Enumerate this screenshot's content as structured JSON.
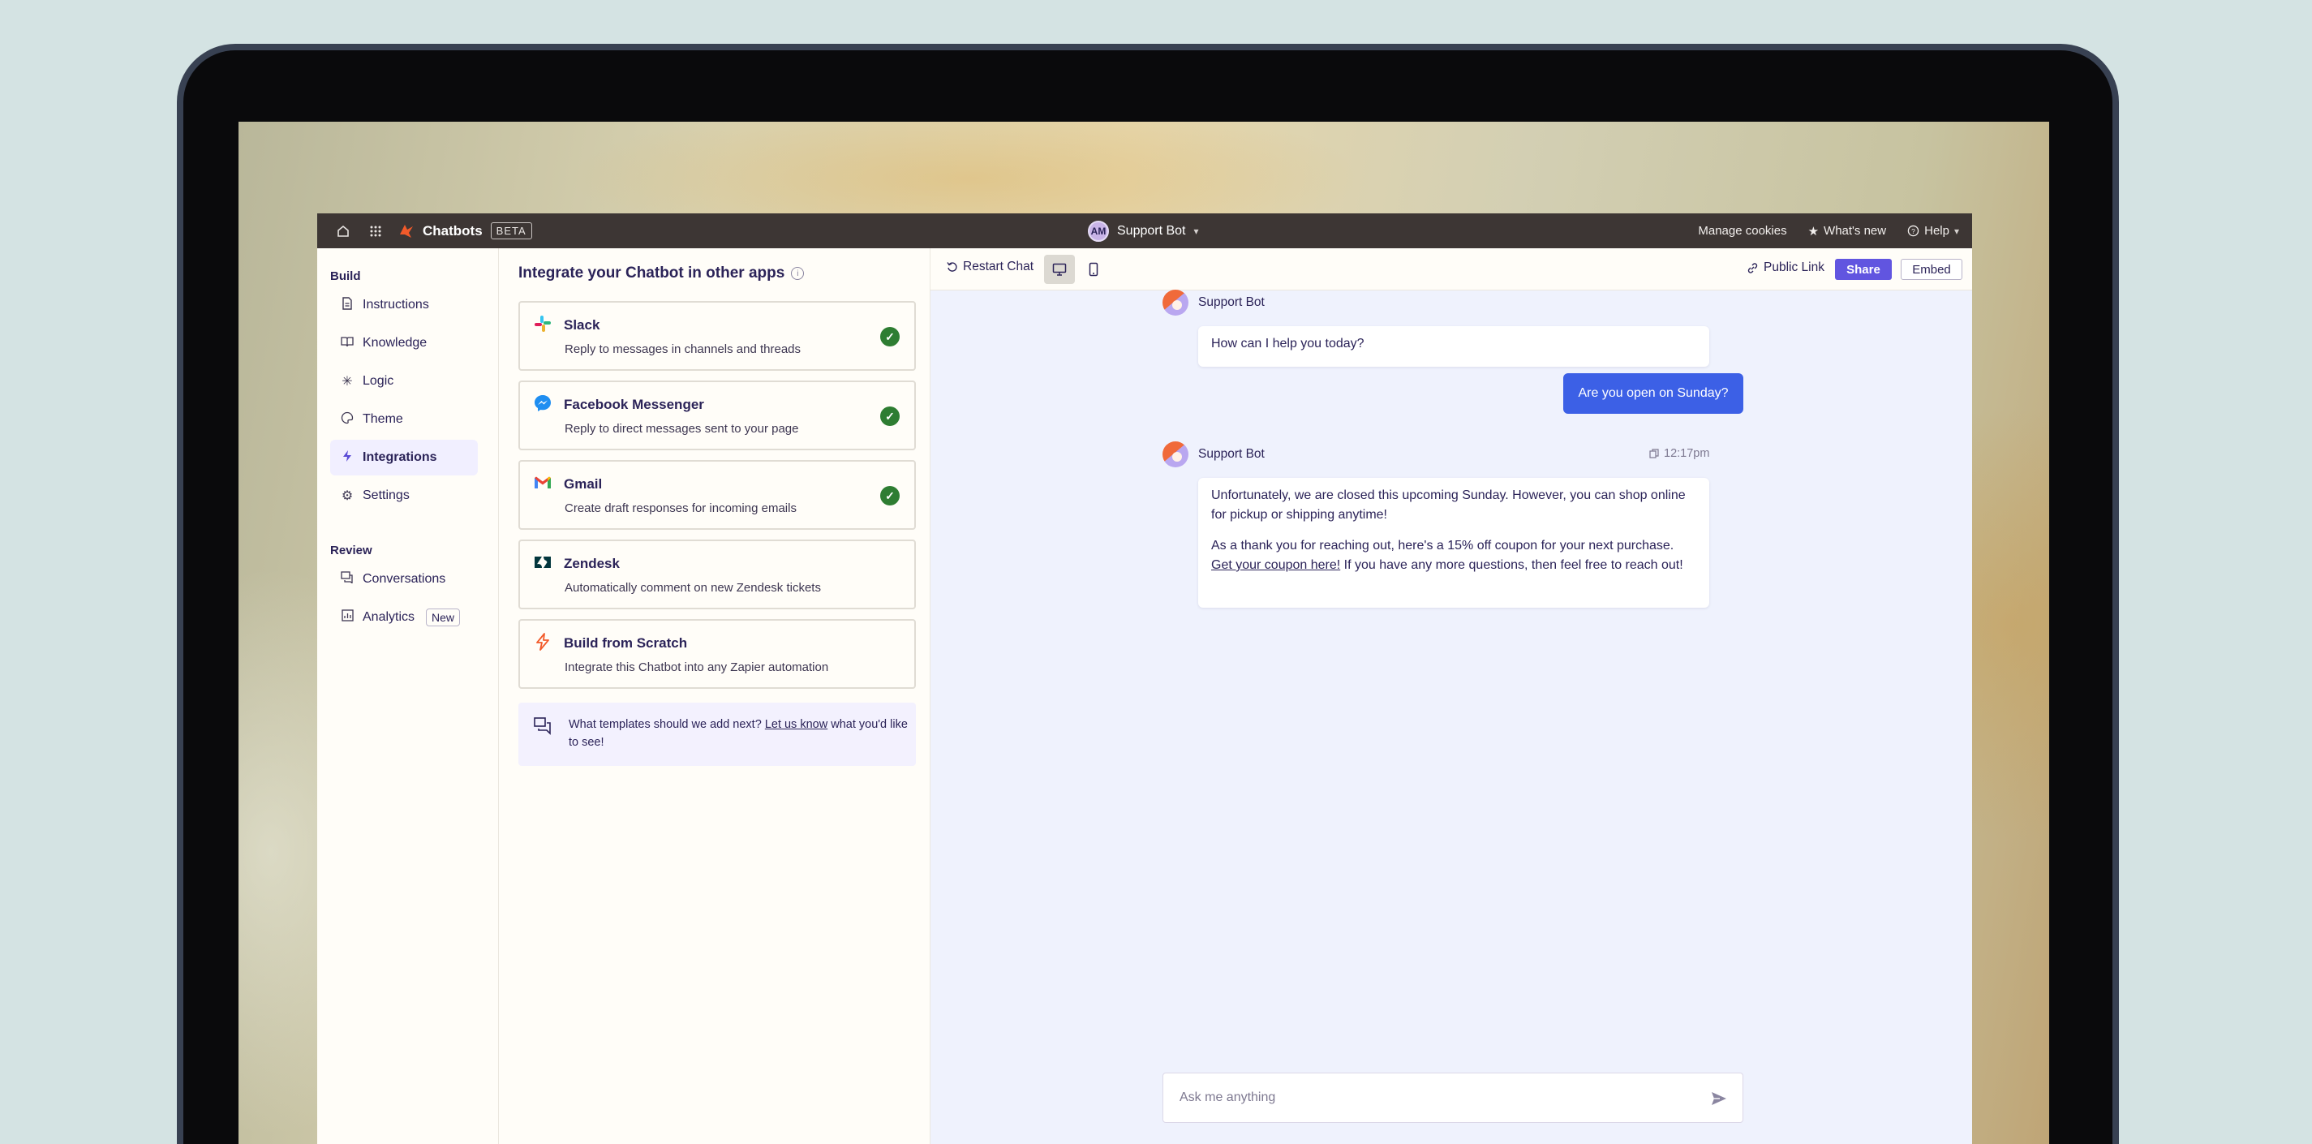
{
  "topbar": {
    "brand_name": "Chatbots",
    "beta_label": "BETA",
    "avatar_initials": "AM",
    "bot_selector": "Support Bot",
    "manage_cookies": "Manage cookies",
    "whats_new": "What's new",
    "help": "Help"
  },
  "sidebar": {
    "build_heading": "Build",
    "review_heading": "Review",
    "build_items": [
      {
        "label": "Instructions",
        "icon": "document-icon"
      },
      {
        "label": "Knowledge",
        "icon": "book-icon"
      },
      {
        "label": "Logic",
        "icon": "asterisk-icon"
      },
      {
        "label": "Theme",
        "icon": "palette-icon"
      },
      {
        "label": "Integrations",
        "icon": "bolt-icon",
        "active": true
      },
      {
        "label": "Settings",
        "icon": "gear-icon"
      }
    ],
    "review_items": [
      {
        "label": "Conversations",
        "icon": "chat-icon"
      },
      {
        "label": "Analytics",
        "icon": "chart-icon",
        "badge": "New"
      }
    ]
  },
  "integrations": {
    "title": "Integrate your Chatbot in other apps",
    "cards": [
      {
        "name": "Slack",
        "description": "Reply to messages in channels and threads",
        "connected": true
      },
      {
        "name": "Facebook Messenger",
        "description": "Reply to direct messages sent to your page",
        "connected": true
      },
      {
        "name": "Gmail",
        "description": "Create draft responses for incoming emails",
        "connected": true
      },
      {
        "name": "Zendesk",
        "description": "Automatically comment on new Zendesk tickets",
        "connected": false
      },
      {
        "name": "Build from Scratch",
        "description": "Integrate this Chatbot into any Zapier automation",
        "connected": false
      }
    ],
    "tip": {
      "before": "What templates should we add next? ",
      "link": "Let us know",
      "after": " what you'd like to see!"
    }
  },
  "chat_toolbar": {
    "restart": "Restart Chat",
    "public_link": "Public Link",
    "share": "Share",
    "embed": "Embed"
  },
  "chat": {
    "bot_name": "Support Bot",
    "greeting": "How can I help you today?",
    "user_message": "Are you open on Sunday?",
    "timestamp": "12:17pm",
    "reply_p1": "Unfortunately, we are closed this upcoming Sunday. However, you can shop online for pickup or shipping anytime!",
    "reply_p2_before": "As a thank you for reaching out, here's a 15% off coupon for your next purchase. ",
    "reply_p2_link": "Get your coupon here!",
    "reply_p2_after": " If you have any more questions, then feel free to reach out!",
    "input_placeholder": "Ask me anything"
  },
  "colors": {
    "share_button": "#6155e0",
    "user_bubble": "#3c60e6",
    "connected_check": "#2e7d32",
    "topbar": "#3d3634"
  }
}
